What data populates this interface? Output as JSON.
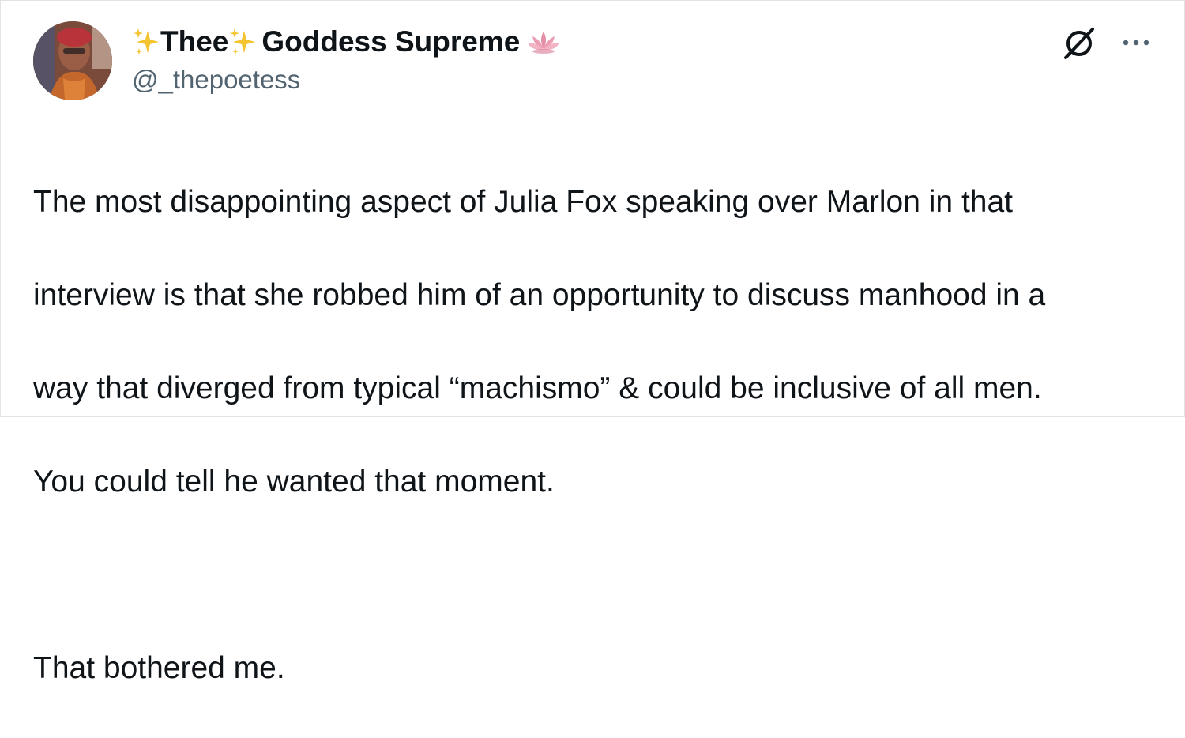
{
  "author": {
    "display_name_part1": "Thee",
    "display_name_part2": "Goddess Supreme",
    "handle": "@_thepoetess",
    "avatar_icon": "avatar-photo",
    "name_emojis": [
      "sparkles-emoji",
      "sparkles-emoji",
      "lotus-emoji"
    ]
  },
  "actions": {
    "grok_icon": "grok-icon",
    "more_icon": "more-options-icon"
  },
  "tweet": {
    "line1": "The most disappointing aspect of Julia Fox speaking over Marlon in that",
    "line2": "interview is that she robbed him of an opportunity to discuss manhood in a",
    "line3": "way that diverged from typical “machismo” & could be inclusive of all men.",
    "line4": "You could tell he wanted that moment.",
    "line5": "That bothered me."
  },
  "colors": {
    "text": "#0f1419",
    "secondary_text": "#536471",
    "sparkle": "#f4c430",
    "lotus": "#e58fa6"
  }
}
